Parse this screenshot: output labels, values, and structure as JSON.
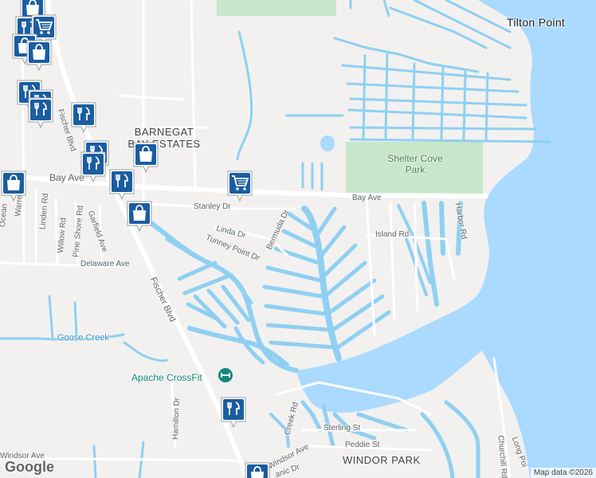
{
  "map": {
    "places": {
      "tilton_point": "Tilton Point",
      "barnegat_bay_estates": "BARNEGAT BAY ESTATES",
      "windor_park": "WINDOR PARK"
    },
    "parks": {
      "shelter_cove_park": "Shelter Cove Park"
    },
    "pois": {
      "apache_crossfit": "Apache CrossFit"
    },
    "streets": {
      "bay_ave_west": "Bay Ave",
      "bay_ave_east": "Bay Ave",
      "stanley_dr": "Stanley Dr",
      "linda_dr": "Linda Dr",
      "bermuda_dr": "Bermuda Dr",
      "tunney_point_dr": "Tunney Point Dr",
      "island_rd": "Island Rd",
      "harbor_rd": "Harbor Rd",
      "delaware_ave": "Delaware Ave",
      "fischer_blvd_north": "Fischer Blvd",
      "fischer_blvd_south": "Fischer Blvd",
      "goose_creek": "Goose Creek",
      "hamilton_dr": "Hamilton Dr",
      "creek_rd": "Creek Rd",
      "windsor_ave_west": "Windsor Ave",
      "windsor_ave_east": "Windsor Ave",
      "sterling_st": "Sterling St",
      "peddie_st": "Peddie St",
      "churchill_rd": "Churchill Rd",
      "long_point": "Long Poi",
      "linden_rd": "Linden Rd",
      "willow_rd": "Willow Rd",
      "pine_shore_rd": "Pine Shore Rd",
      "garfield_ave": "Garfield Ave",
      "warren": "Warren",
      "ocean_ave": "Ocean",
      "manic_dr": "anic Dr"
    },
    "attribution": {
      "logo": "Google",
      "credit": "Map data ©2026"
    },
    "colors": {
      "water": "#aadaff",
      "canal": "#8fd0f2",
      "land": "#f2f1ef",
      "park": "#c8e6c9",
      "road": "#ffffff",
      "marker_fill": "#1a5da1",
      "poi_teal": "#13877d"
    },
    "markers": [
      {
        "type": "shopping-bag",
        "id": "m1"
      },
      {
        "type": "restaurant",
        "id": "m2"
      },
      {
        "type": "shopping-cart",
        "id": "m3"
      },
      {
        "type": "shopping-bag",
        "id": "m4"
      },
      {
        "type": "shopping-bag",
        "id": "m5"
      },
      {
        "type": "restaurant",
        "id": "m6"
      },
      {
        "type": "restaurant",
        "id": "m7"
      },
      {
        "type": "restaurant",
        "id": "m8"
      },
      {
        "type": "restaurant",
        "id": "m9"
      },
      {
        "type": "restaurant",
        "id": "m10"
      },
      {
        "type": "shopping-bag",
        "id": "m11"
      },
      {
        "type": "restaurant",
        "id": "m12"
      },
      {
        "type": "restaurant",
        "id": "m13"
      },
      {
        "type": "shopping-cart",
        "id": "m14"
      },
      {
        "type": "shopping-bag",
        "id": "m15"
      },
      {
        "type": "shopping-bag",
        "id": "m16"
      },
      {
        "type": "restaurant",
        "id": "m17"
      },
      {
        "type": "shopping-bag",
        "id": "m18"
      }
    ]
  }
}
